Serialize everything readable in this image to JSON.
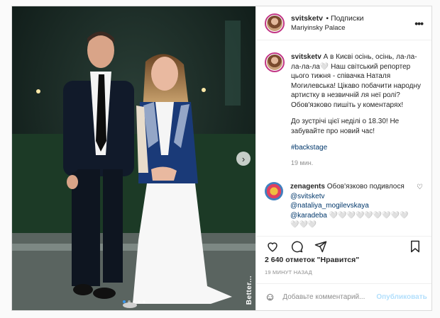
{
  "post": {
    "username": "svitsketv",
    "follow_text": "• Подписки",
    "location": "Mariyinsky Palace",
    "caption_line1": "А в Києві осінь, осінь, ла-ла-ла-ла-ла🤍 Наш світський репортер цього тижня - співачка Наталя Могилевська! Цікаво побачити народну артистку в незвичній ля неї ролі? Обов'язково пишіть у коментарях!",
    "caption_line2": "До зустрічі цієї неділі о 18.30! Не забувайте про новий час!",
    "hashtag": "#backstage",
    "caption_time": "19 мин.",
    "comment": {
      "username": "zenagents",
      "text": "Обов'язково подивлося",
      "mention1": "@svitsketv",
      "mention2": "@nataliya_mogilevskaya",
      "mention3": "@karadeba 🤍🤍🤍🤍🤍🤍🤍🤍🤍🤍🤍🤍"
    },
    "likes": "2 640 отметок \"Нравится\"",
    "time_ago": "19 МИНУТ НАЗАД",
    "comment_placeholder": "Добавьте комментарий...",
    "publish_label": "Опубликовать",
    "watermark": "Better..."
  },
  "icons": {
    "more": "more-dots-icon",
    "heart": "heart-icon",
    "comment": "comment-icon",
    "share": "share-icon",
    "save": "bookmark-icon",
    "emoji": "emoji-icon",
    "next": "chevron-right-icon"
  },
  "colors": {
    "link": "#00376b",
    "accent": "#3897f0",
    "publish": "#b2dffc"
  }
}
